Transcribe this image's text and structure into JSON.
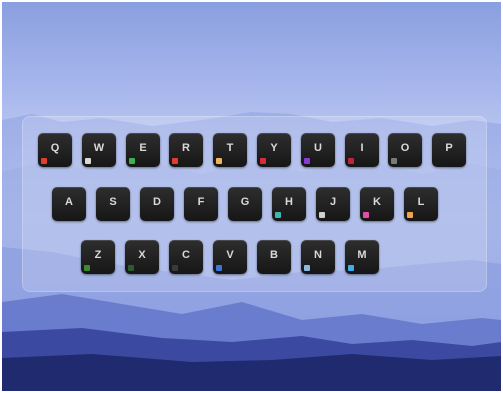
{
  "keyboard": {
    "row1": [
      {
        "label": "Q",
        "icon": "red-app-icon",
        "color": "#e0402a"
      },
      {
        "label": "W",
        "icon": "white-app-icon",
        "color": "#d8d8d8"
      },
      {
        "label": "E",
        "icon": "green-app-icon",
        "color": "#3bb34a"
      },
      {
        "label": "R",
        "icon": "red-check-icon",
        "color": "#e43b2f"
      },
      {
        "label": "T",
        "icon": "orange-app-icon",
        "color": "#f0b35a"
      },
      {
        "label": "Y",
        "icon": "red-app-icon",
        "color": "#d92b3a"
      },
      {
        "label": "U",
        "icon": "purple-app-icon",
        "color": "#8a3bd6"
      },
      {
        "label": "I",
        "icon": "red-app-icon",
        "color": "#c02438"
      },
      {
        "label": "O",
        "icon": "gray-app-icon",
        "color": "#7a7a7a"
      },
      {
        "label": "P",
        "icon": "",
        "color": ""
      }
    ],
    "row2": [
      {
        "label": "A",
        "icon": "",
        "color": ""
      },
      {
        "label": "S",
        "icon": "",
        "color": ""
      },
      {
        "label": "D",
        "icon": "",
        "color": ""
      },
      {
        "label": "F",
        "icon": "",
        "color": ""
      },
      {
        "label": "G",
        "icon": "",
        "color": ""
      },
      {
        "label": "H",
        "icon": "teal-app-icon",
        "color": "#3fb6b0"
      },
      {
        "label": "J",
        "icon": "white-app-icon",
        "color": "#cfcfcf"
      },
      {
        "label": "K",
        "icon": "pink-app-icon",
        "color": "#e24fa8"
      },
      {
        "label": "L",
        "icon": "orange-app-icon",
        "color": "#f4a24a"
      }
    ],
    "row3": [
      {
        "label": "Z",
        "icon": "green-app-icon",
        "color": "#3b8a2f"
      },
      {
        "label": "X",
        "icon": "dark-green-app-icon",
        "color": "#2c5a2a"
      },
      {
        "label": "C",
        "icon": "dark-app-icon",
        "color": "#3a3a3a"
      },
      {
        "label": "V",
        "icon": "blue-app-icon",
        "color": "#3a78d8"
      },
      {
        "label": "B",
        "icon": "",
        "color": ""
      },
      {
        "label": "N",
        "icon": "light-blue-app-icon",
        "color": "#8fb8e0"
      },
      {
        "label": "M",
        "icon": "cyan-app-icon",
        "color": "#3ab0e8"
      }
    ]
  }
}
